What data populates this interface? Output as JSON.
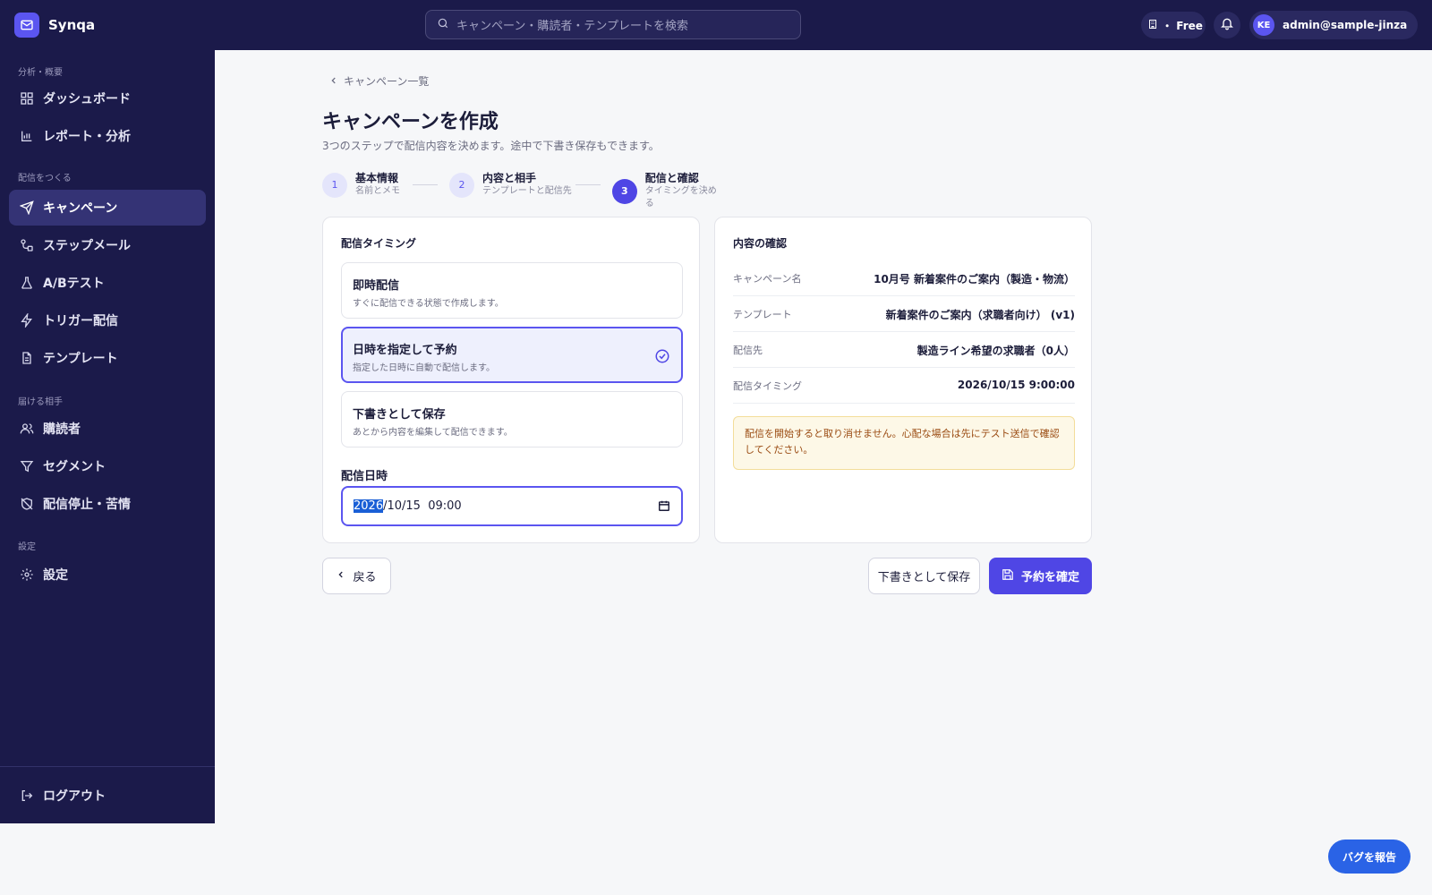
{
  "app": {
    "name": "Synqa"
  },
  "header": {
    "search_placeholder": "キャンペーン・購読者・テンプレートを検索",
    "plan_label": "・ Free",
    "user_initials": "KE",
    "user_email": "admin@sample-jinzai.e..."
  },
  "sidebar": {
    "sections": [
      "分析・概要",
      "配信をつくる",
      "届ける相手",
      "設定"
    ],
    "items": [
      {
        "label": "ダッシュボード",
        "icon": "grid-icon"
      },
      {
        "label": "レポート・分析",
        "icon": "bar-chart-icon"
      },
      {
        "label": "キャンペーン",
        "icon": "send-icon",
        "active": true
      },
      {
        "label": "ステップメール",
        "icon": "workflow-icon"
      },
      {
        "label": "A/Bテスト",
        "icon": "flask-icon"
      },
      {
        "label": "トリガー配信",
        "icon": "zap-icon"
      },
      {
        "label": "テンプレート",
        "icon": "file-icon"
      },
      {
        "label": "購読者",
        "icon": "users-icon"
      },
      {
        "label": "セグメント",
        "icon": "filter-icon"
      },
      {
        "label": "配信停止・苦情",
        "icon": "shield-off-icon"
      },
      {
        "label": "設定",
        "icon": "gear-icon"
      }
    ],
    "logout_label": "ログアウト"
  },
  "page": {
    "breadcrumb": "キャンペーン一覧",
    "title": "キャンペーンを作成",
    "subtitle": "3つのステップで配信内容を決めます。途中で下書き保存もできます。"
  },
  "steps": [
    {
      "num": "1",
      "title": "基本情報",
      "desc": "名前とメモ"
    },
    {
      "num": "2",
      "title": "内容と相手",
      "desc": "テンプレートと配信先"
    },
    {
      "num": "3",
      "title": "配信と確認",
      "desc": "タイミングを決める",
      "current": true
    }
  ],
  "timing": {
    "title": "配信タイミング",
    "options": [
      {
        "title": "即時配信",
        "desc": "すぐに配信できる状態で作成します。"
      },
      {
        "title": "日時を指定して予約",
        "desc": "指定した日時に自動で配信します。",
        "selected": true
      },
      {
        "title": "下書きとして保存",
        "desc": "あとから内容を編集して配信できます。"
      }
    ],
    "date_label": "配信日時",
    "date_year": "2026",
    "date_rest": "/10/15  09:00"
  },
  "review": {
    "title": "内容の確認",
    "rows": [
      {
        "key": "キャンペーン名",
        "value": "10月号 新着案件のご案内（製造・物流）"
      },
      {
        "key": "テンプレート",
        "value": "新着案件のご案内（求職者向け） (v1)"
      },
      {
        "key": "配信先",
        "value": "製造ライン希望の求職者（0人）"
      },
      {
        "key": "配信タイミング",
        "value": "2026/10/15 9:00:00"
      }
    ],
    "warning": "配信を開始すると取り消せません。心配な場合は先にテスト送信で確認してください。"
  },
  "actions": {
    "back": "戻る",
    "save_draft": "下書きとして保存",
    "confirm": "予約を確定"
  },
  "bug_report": "バグを報告",
  "colors": {
    "sidebar": "#1b1a4a",
    "accent": "#4f46e5",
    "warning_bg": "#fdf8e7"
  }
}
